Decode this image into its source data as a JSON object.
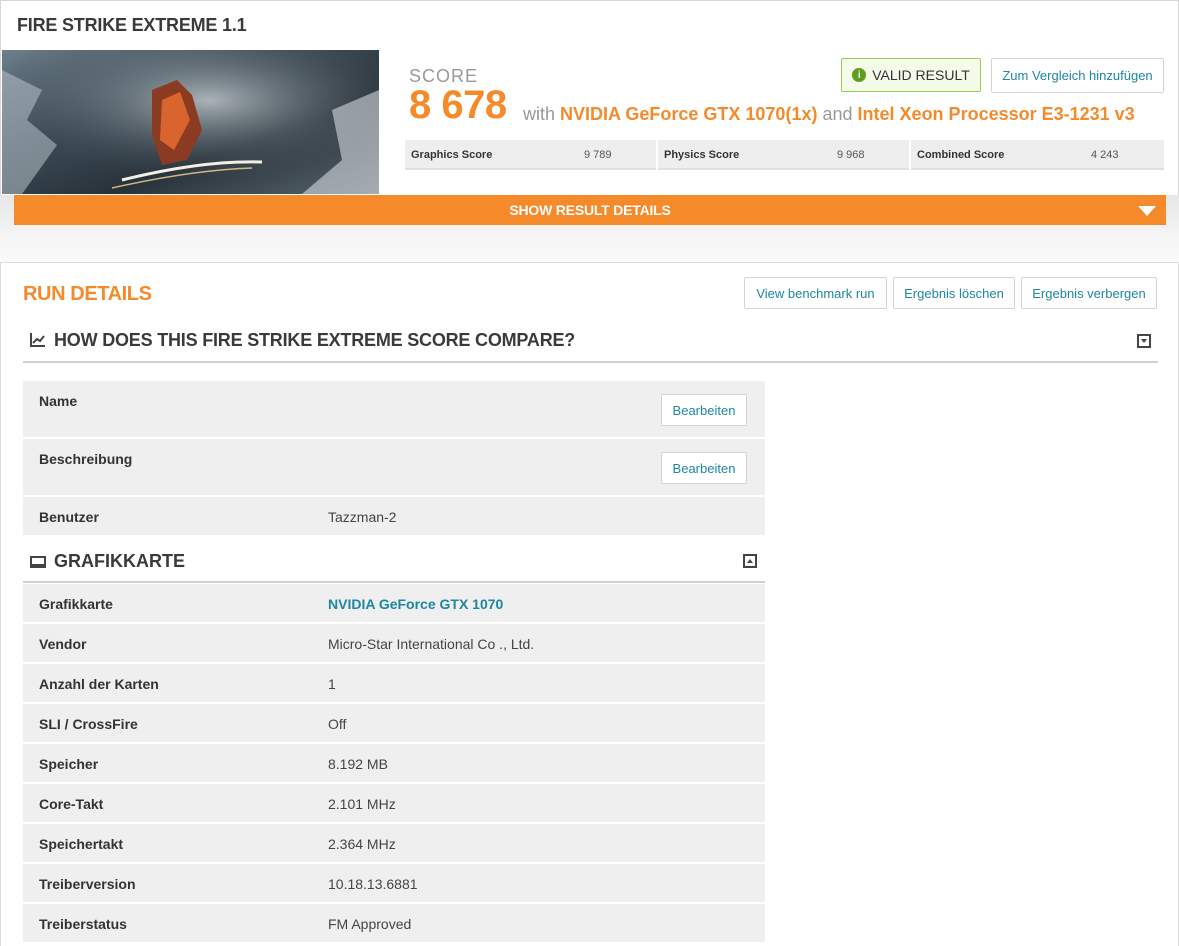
{
  "header": {
    "title": "FIRE STRIKE EXTREME 1.1"
  },
  "result": {
    "score_label": "SCORE",
    "score_value": "8 678",
    "with_text": "with",
    "gpu": "NVIDIA GeForce GTX 1070(1x)",
    "and_text": "and",
    "cpu": "Intel Xeon Processor E3-1231 v3",
    "valid_label": "VALID RESULT",
    "compare_label": "Zum Vergleich hinzufügen",
    "subscores": [
      {
        "label": "Graphics Score",
        "value": "9 789"
      },
      {
        "label": "Physics Score",
        "value": "9 968"
      },
      {
        "label": "Combined Score",
        "value": "4 243"
      }
    ],
    "show_details_label": "SHOW RESULT DETAILS"
  },
  "run_details": {
    "title": "RUN DETAILS",
    "buttons": {
      "view_run": "View benchmark run",
      "delete": "Ergebnis löschen",
      "hide": "Ergebnis verbergen"
    },
    "compare_heading": "HOW DOES THIS FIRE STRIKE EXTREME SCORE COMPARE?",
    "info_rows": [
      {
        "key": "Name",
        "edit": "Bearbeiten"
      },
      {
        "key": "Beschreibung",
        "edit": "Bearbeiten"
      },
      {
        "key": "Benutzer",
        "value": "Tazzman-2"
      }
    ]
  },
  "graphics": {
    "heading": "GRAFIKKARTE",
    "rows": [
      {
        "key": "Grafikkarte",
        "value": "NVIDIA GeForce GTX 1070"
      },
      {
        "key": "Vendor",
        "value": "Micro-Star International Co ., Ltd."
      },
      {
        "key": "Anzahl der Karten",
        "value": "1"
      },
      {
        "key": "SLI / CrossFire",
        "value": "Off"
      },
      {
        "key": "Speicher",
        "value": "8.192 MB"
      },
      {
        "key": "Core-Takt",
        "value": "2.101 MHz"
      },
      {
        "key": "Speichertakt",
        "value": "2.364 MHz"
      },
      {
        "key": "Treiberversion",
        "value": "10.18.13.6881"
      },
      {
        "key": "Treiberstatus",
        "value": "FM Approved"
      }
    ]
  },
  "colors": {
    "accent": "#f58a2b",
    "link": "#1d86a3",
    "valid": "#5e9e1c"
  },
  "icons": [
    "chart-icon",
    "info-icon",
    "monitor-icon",
    "collapse-icon",
    "expand-icon",
    "dropdown-arrow-icon"
  ]
}
